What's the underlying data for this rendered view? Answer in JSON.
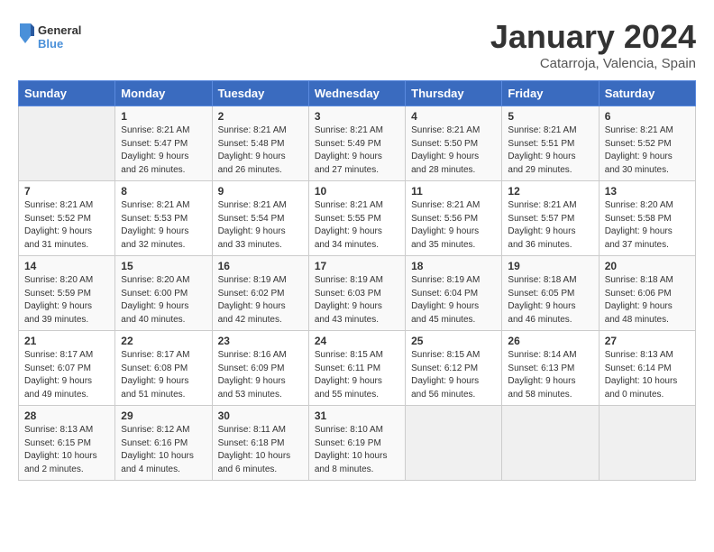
{
  "header": {
    "logo_line1": "General",
    "logo_line2": "Blue",
    "month_title": "January 2024",
    "location": "Catarroja, Valencia, Spain"
  },
  "weekdays": [
    "Sunday",
    "Monday",
    "Tuesday",
    "Wednesday",
    "Thursday",
    "Friday",
    "Saturday"
  ],
  "weeks": [
    [
      {
        "day": "",
        "sunrise": "",
        "sunset": "",
        "daylight": ""
      },
      {
        "day": "1",
        "sunrise": "Sunrise: 8:21 AM",
        "sunset": "Sunset: 5:47 PM",
        "daylight": "Daylight: 9 hours and 26 minutes."
      },
      {
        "day": "2",
        "sunrise": "Sunrise: 8:21 AM",
        "sunset": "Sunset: 5:48 PM",
        "daylight": "Daylight: 9 hours and 26 minutes."
      },
      {
        "day": "3",
        "sunrise": "Sunrise: 8:21 AM",
        "sunset": "Sunset: 5:49 PM",
        "daylight": "Daylight: 9 hours and 27 minutes."
      },
      {
        "day": "4",
        "sunrise": "Sunrise: 8:21 AM",
        "sunset": "Sunset: 5:50 PM",
        "daylight": "Daylight: 9 hours and 28 minutes."
      },
      {
        "day": "5",
        "sunrise": "Sunrise: 8:21 AM",
        "sunset": "Sunset: 5:51 PM",
        "daylight": "Daylight: 9 hours and 29 minutes."
      },
      {
        "day": "6",
        "sunrise": "Sunrise: 8:21 AM",
        "sunset": "Sunset: 5:52 PM",
        "daylight": "Daylight: 9 hours and 30 minutes."
      }
    ],
    [
      {
        "day": "7",
        "sunrise": "Sunrise: 8:21 AM",
        "sunset": "Sunset: 5:52 PM",
        "daylight": "Daylight: 9 hours and 31 minutes."
      },
      {
        "day": "8",
        "sunrise": "Sunrise: 8:21 AM",
        "sunset": "Sunset: 5:53 PM",
        "daylight": "Daylight: 9 hours and 32 minutes."
      },
      {
        "day": "9",
        "sunrise": "Sunrise: 8:21 AM",
        "sunset": "Sunset: 5:54 PM",
        "daylight": "Daylight: 9 hours and 33 minutes."
      },
      {
        "day": "10",
        "sunrise": "Sunrise: 8:21 AM",
        "sunset": "Sunset: 5:55 PM",
        "daylight": "Daylight: 9 hours and 34 minutes."
      },
      {
        "day": "11",
        "sunrise": "Sunrise: 8:21 AM",
        "sunset": "Sunset: 5:56 PM",
        "daylight": "Daylight: 9 hours and 35 minutes."
      },
      {
        "day": "12",
        "sunrise": "Sunrise: 8:21 AM",
        "sunset": "Sunset: 5:57 PM",
        "daylight": "Daylight: 9 hours and 36 minutes."
      },
      {
        "day": "13",
        "sunrise": "Sunrise: 8:20 AM",
        "sunset": "Sunset: 5:58 PM",
        "daylight": "Daylight: 9 hours and 37 minutes."
      }
    ],
    [
      {
        "day": "14",
        "sunrise": "Sunrise: 8:20 AM",
        "sunset": "Sunset: 5:59 PM",
        "daylight": "Daylight: 9 hours and 39 minutes."
      },
      {
        "day": "15",
        "sunrise": "Sunrise: 8:20 AM",
        "sunset": "Sunset: 6:00 PM",
        "daylight": "Daylight: 9 hours and 40 minutes."
      },
      {
        "day": "16",
        "sunrise": "Sunrise: 8:19 AM",
        "sunset": "Sunset: 6:02 PM",
        "daylight": "Daylight: 9 hours and 42 minutes."
      },
      {
        "day": "17",
        "sunrise": "Sunrise: 8:19 AM",
        "sunset": "Sunset: 6:03 PM",
        "daylight": "Daylight: 9 hours and 43 minutes."
      },
      {
        "day": "18",
        "sunrise": "Sunrise: 8:19 AM",
        "sunset": "Sunset: 6:04 PM",
        "daylight": "Daylight: 9 hours and 45 minutes."
      },
      {
        "day": "19",
        "sunrise": "Sunrise: 8:18 AM",
        "sunset": "Sunset: 6:05 PM",
        "daylight": "Daylight: 9 hours and 46 minutes."
      },
      {
        "day": "20",
        "sunrise": "Sunrise: 8:18 AM",
        "sunset": "Sunset: 6:06 PM",
        "daylight": "Daylight: 9 hours and 48 minutes."
      }
    ],
    [
      {
        "day": "21",
        "sunrise": "Sunrise: 8:17 AM",
        "sunset": "Sunset: 6:07 PM",
        "daylight": "Daylight: 9 hours and 49 minutes."
      },
      {
        "day": "22",
        "sunrise": "Sunrise: 8:17 AM",
        "sunset": "Sunset: 6:08 PM",
        "daylight": "Daylight: 9 hours and 51 minutes."
      },
      {
        "day": "23",
        "sunrise": "Sunrise: 8:16 AM",
        "sunset": "Sunset: 6:09 PM",
        "daylight": "Daylight: 9 hours and 53 minutes."
      },
      {
        "day": "24",
        "sunrise": "Sunrise: 8:15 AM",
        "sunset": "Sunset: 6:11 PM",
        "daylight": "Daylight: 9 hours and 55 minutes."
      },
      {
        "day": "25",
        "sunrise": "Sunrise: 8:15 AM",
        "sunset": "Sunset: 6:12 PM",
        "daylight": "Daylight: 9 hours and 56 minutes."
      },
      {
        "day": "26",
        "sunrise": "Sunrise: 8:14 AM",
        "sunset": "Sunset: 6:13 PM",
        "daylight": "Daylight: 9 hours and 58 minutes."
      },
      {
        "day": "27",
        "sunrise": "Sunrise: 8:13 AM",
        "sunset": "Sunset: 6:14 PM",
        "daylight": "Daylight: 10 hours and 0 minutes."
      }
    ],
    [
      {
        "day": "28",
        "sunrise": "Sunrise: 8:13 AM",
        "sunset": "Sunset: 6:15 PM",
        "daylight": "Daylight: 10 hours and 2 minutes."
      },
      {
        "day": "29",
        "sunrise": "Sunrise: 8:12 AM",
        "sunset": "Sunset: 6:16 PM",
        "daylight": "Daylight: 10 hours and 4 minutes."
      },
      {
        "day": "30",
        "sunrise": "Sunrise: 8:11 AM",
        "sunset": "Sunset: 6:18 PM",
        "daylight": "Daylight: 10 hours and 6 minutes."
      },
      {
        "day": "31",
        "sunrise": "Sunrise: 8:10 AM",
        "sunset": "Sunset: 6:19 PM",
        "daylight": "Daylight: 10 hours and 8 minutes."
      },
      {
        "day": "",
        "sunrise": "",
        "sunset": "",
        "daylight": ""
      },
      {
        "day": "",
        "sunrise": "",
        "sunset": "",
        "daylight": ""
      },
      {
        "day": "",
        "sunrise": "",
        "sunset": "",
        "daylight": ""
      }
    ]
  ]
}
